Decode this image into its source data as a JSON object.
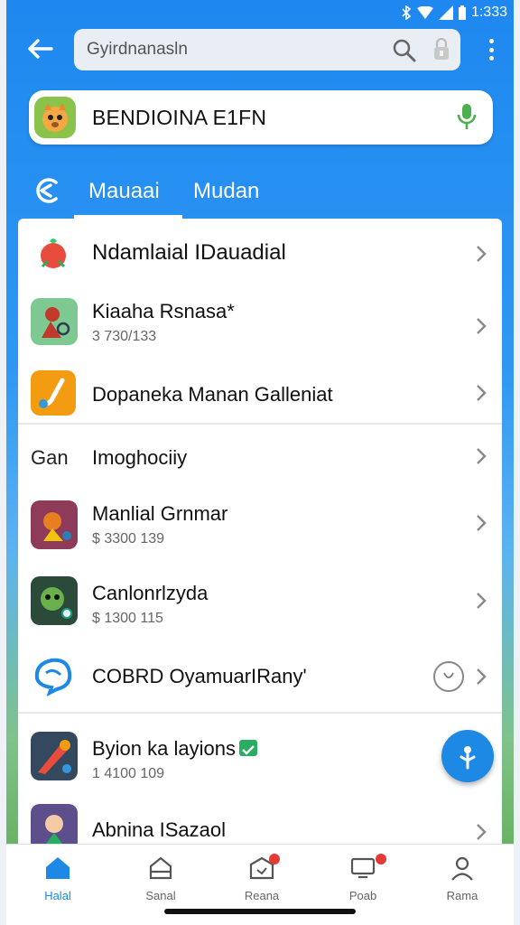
{
  "status_bar": {
    "time": "1:333"
  },
  "header": {
    "search_value": "Gyirdnanasln"
  },
  "voice_bar": {
    "title": "BENDIOINA E1FN"
  },
  "tabs": [
    {
      "label": "Mauaai"
    },
    {
      "label": "Mudan"
    }
  ],
  "list": {
    "items": [
      {
        "title": "Ndamlaial IDauadial",
        "subtitle": ""
      },
      {
        "title": "Kiaaha Rsnasa*",
        "subtitle": "3 730/133"
      },
      {
        "title": "Dopaneka Manan Galleniat",
        "subtitle": ""
      },
      {
        "title": "Imoghociiy",
        "subtitle": "",
        "icon_text": "Gan"
      },
      {
        "title": "Manlial Grnmar",
        "subtitle": "$ 3300 139"
      },
      {
        "title": "Canlonrlzyda",
        "subtitle": "$ 1300 115"
      },
      {
        "title": "COBRD OyamuarIRany'",
        "subtitle": ""
      },
      {
        "title": "Byion ka layions",
        "subtitle": "1 4100 109"
      },
      {
        "title": "Abnina ISazaol",
        "subtitle": ""
      }
    ]
  },
  "bottom_nav": [
    {
      "label": "Halal"
    },
    {
      "label": "Sanal"
    },
    {
      "label": "Reana"
    },
    {
      "label": "Poab"
    },
    {
      "label": "Rama"
    }
  ],
  "colors": {
    "accent": "#1e88e5",
    "status_badge": "#e53935",
    "check_badge": "#27ae60"
  }
}
